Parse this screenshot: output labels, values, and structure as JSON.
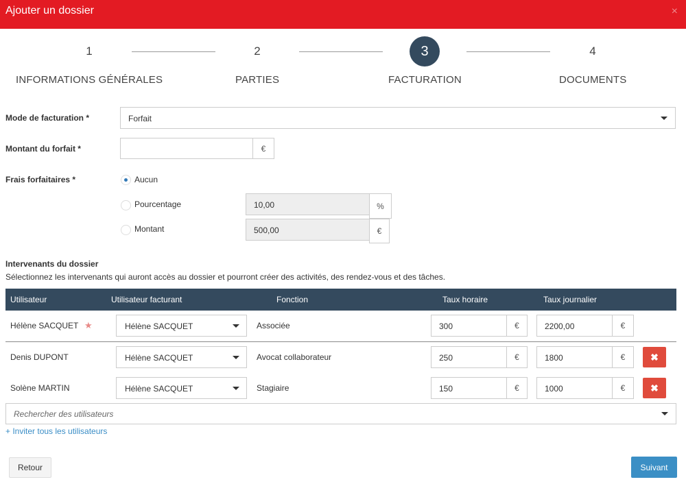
{
  "dialog": {
    "title": "Ajouter un dossier",
    "close_glyph": "×"
  },
  "stepper": {
    "steps": [
      {
        "number": "1",
        "label": "INFORMATIONS GÉNÉRALES"
      },
      {
        "number": "2",
        "label": "PARTIES"
      },
      {
        "number": "3",
        "label": "FACTURATION"
      },
      {
        "number": "4",
        "label": "DOCUMENTS"
      }
    ],
    "active_step": 3
  },
  "billing": {
    "mode_label": "Mode de facturation *",
    "mode_value": "Forfait",
    "amount_label": "Montant du forfait *",
    "amount_value": "",
    "currency": "€",
    "fees_label": "Frais forfaitaires *",
    "fees_options": {
      "none": {
        "label": "Aucun",
        "checked": true
      },
      "percent": {
        "label": "Pourcentage",
        "value": "10,00",
        "unit": "%"
      },
      "amount": {
        "label": "Montant",
        "value": "500,00",
        "unit": "€"
      }
    }
  },
  "participants": {
    "title": "Intervenants du dossier",
    "description": "Sélectionnez les intervenants qui auront accès au dossier et pourront créer des activités, des rendez-vous et des tâches.",
    "columns": [
      "Utilisateur",
      "Utilisateur facturant",
      "Fonction",
      "Taux horaire",
      "Taux journalier"
    ],
    "rows": [
      {
        "user": "Hélène SACQUET",
        "owner": true,
        "billing_user": "Hélène SACQUET",
        "function": "Associée",
        "hourly": "300",
        "daily": "2200,00",
        "removable": false
      },
      {
        "user": "Denis DUPONT",
        "owner": false,
        "billing_user": "Hélène SACQUET",
        "function": "Avocat collaborateur",
        "hourly": "250",
        "daily": "1800",
        "removable": true
      },
      {
        "user": "Solène MARTIN",
        "owner": false,
        "billing_user": "Hélène SACQUET",
        "function": "Stagiaire",
        "hourly": "150",
        "daily": "1000",
        "removable": true
      }
    ],
    "currency": "€",
    "search_placeholder": "Rechercher des utilisateurs",
    "invite_all": "+ Inviter tous les utilisateurs"
  },
  "footer": {
    "back_label": "Retour",
    "next_label": "Suivant"
  },
  "colors": {
    "header": "#e31b23",
    "table_header": "#344a5e",
    "primary": "#3b8fc5",
    "danger": "#e04b3c"
  },
  "icons": {
    "owner": "star-icon",
    "remove": "times-icon",
    "dropdown": "caret-down-icon"
  }
}
